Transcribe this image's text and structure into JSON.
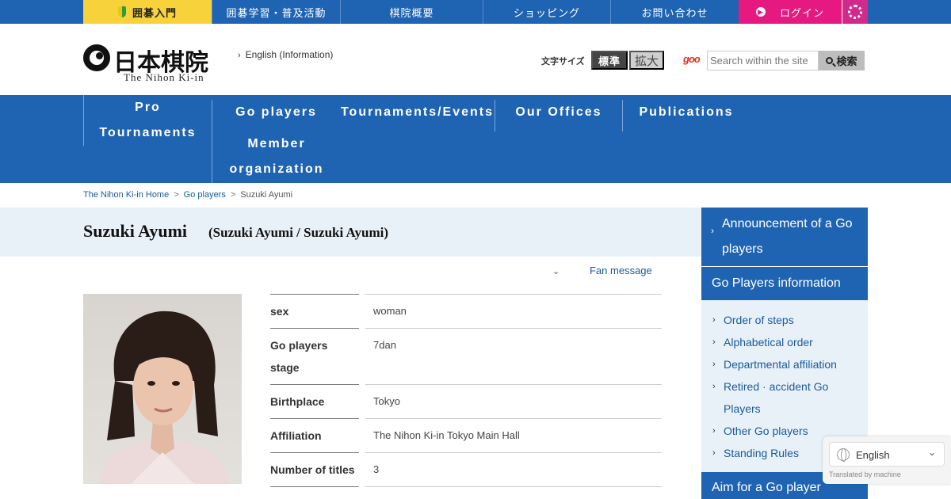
{
  "topbar": {
    "beginner": "囲碁入門",
    "study": "囲碁学習・普及活動",
    "overview": "棋院概要",
    "shopping": "ショッピング",
    "contact": "お問い合わせ",
    "login": "ログイン"
  },
  "header": {
    "logo_jp": "日本棋院",
    "logo_en": "The Nihon Ki-in",
    "english_link": "English (Information)",
    "font_size_label": "文字サイズ",
    "font_size_standard": "標準",
    "font_size_large": "拡大",
    "search_provider": "goo",
    "search_placeholder": "Search within the site",
    "search_button": "検索"
  },
  "nav": {
    "pro_line1": "Pro",
    "pro_line2": "Tournaments",
    "players": "Go players",
    "member_line1": "Member",
    "member_line2": "organization",
    "tournaments": "Tournaments/Events",
    "offices": "Our Offices",
    "publications": "Publications"
  },
  "breadcrumb": {
    "home": "The Nihon Ki-in Home",
    "section": "Go players",
    "current": "Suzuki Ayumi"
  },
  "page": {
    "title": "Suzuki Ayumi",
    "subtitle": "(Suzuki Ayumi / Suzuki Ayumi)",
    "fan_message": "Fan message"
  },
  "profile": [
    {
      "key": "sex",
      "value": "woman"
    },
    {
      "key": "Go players stage",
      "value": "7dan"
    },
    {
      "key": "Birthplace",
      "value": "Tokyo"
    },
    {
      "key": "Affiliation",
      "value": "The Nihon Ki-in Tokyo Main Hall"
    },
    {
      "key": "Number of titles",
      "value": "3"
    }
  ],
  "sidebar": {
    "announcement": "Announcement of a Go players",
    "heading": "Go Players information",
    "items": [
      "Order of steps",
      "Alphabetical order",
      "Departmental affiliation",
      "Retired · accident Go Players",
      "Other Go players",
      "Standing Rules"
    ],
    "aim": "Aim for a Go player"
  },
  "translate": {
    "language": "English",
    "note": "Translated by machine"
  },
  "colors": {
    "brand_blue": "#1f64b2",
    "login_pink": "#e5197f",
    "beginner_yellow": "#f7d23b",
    "band_light": "#e9f1f8"
  }
}
